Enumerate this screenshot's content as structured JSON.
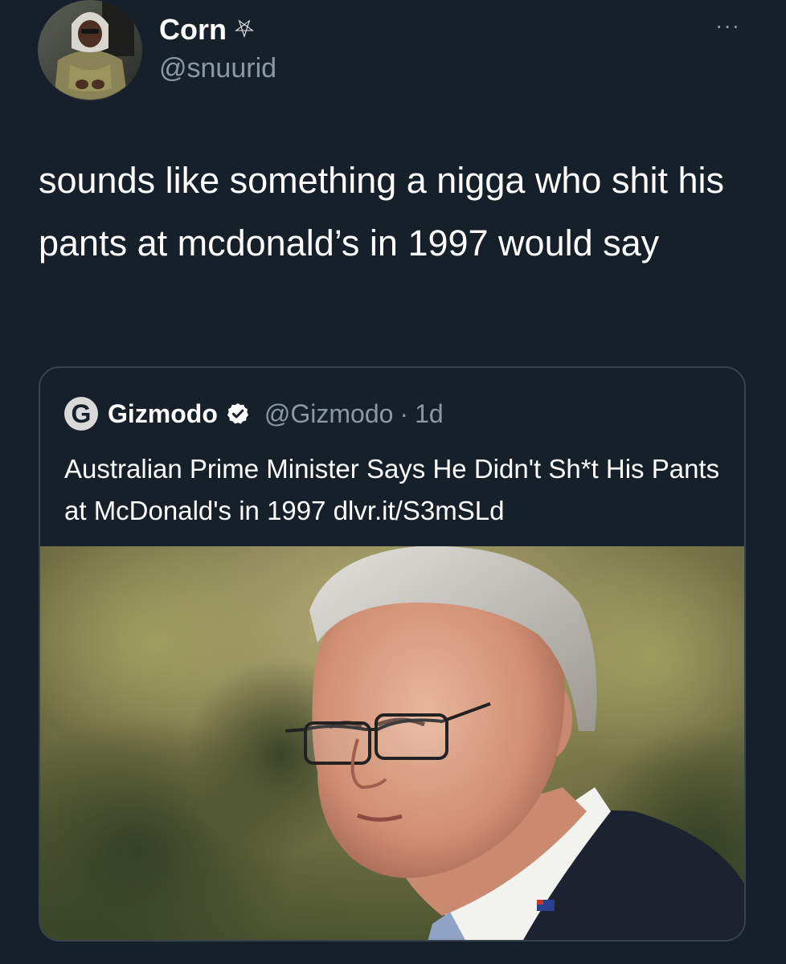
{
  "tweet": {
    "display_name": "Corn",
    "name_emoji": "⛧",
    "handle": "@snuurid",
    "more_label": "···",
    "text": "sounds like something a nigga who shit his pants at mcdonald’s in 1997 would say"
  },
  "quote": {
    "logo_letter": "G",
    "name": "Gizmodo",
    "handle": "@Gizmodo",
    "separator": "·",
    "time": "1d",
    "text": "Australian Prime Minister Says He Didn't Sh*t His Pants at McDonald's in 1997 dlvr.it/S3mSLd"
  },
  "colors": {
    "background": "#15202b",
    "text_primary": "#ffffff",
    "text_secondary": "#8b98a5",
    "border": "#38444d"
  },
  "icons": {
    "more": "more-dots-icon",
    "verified": "verified-badge-icon",
    "logo": "gizmodo-logo-icon"
  }
}
